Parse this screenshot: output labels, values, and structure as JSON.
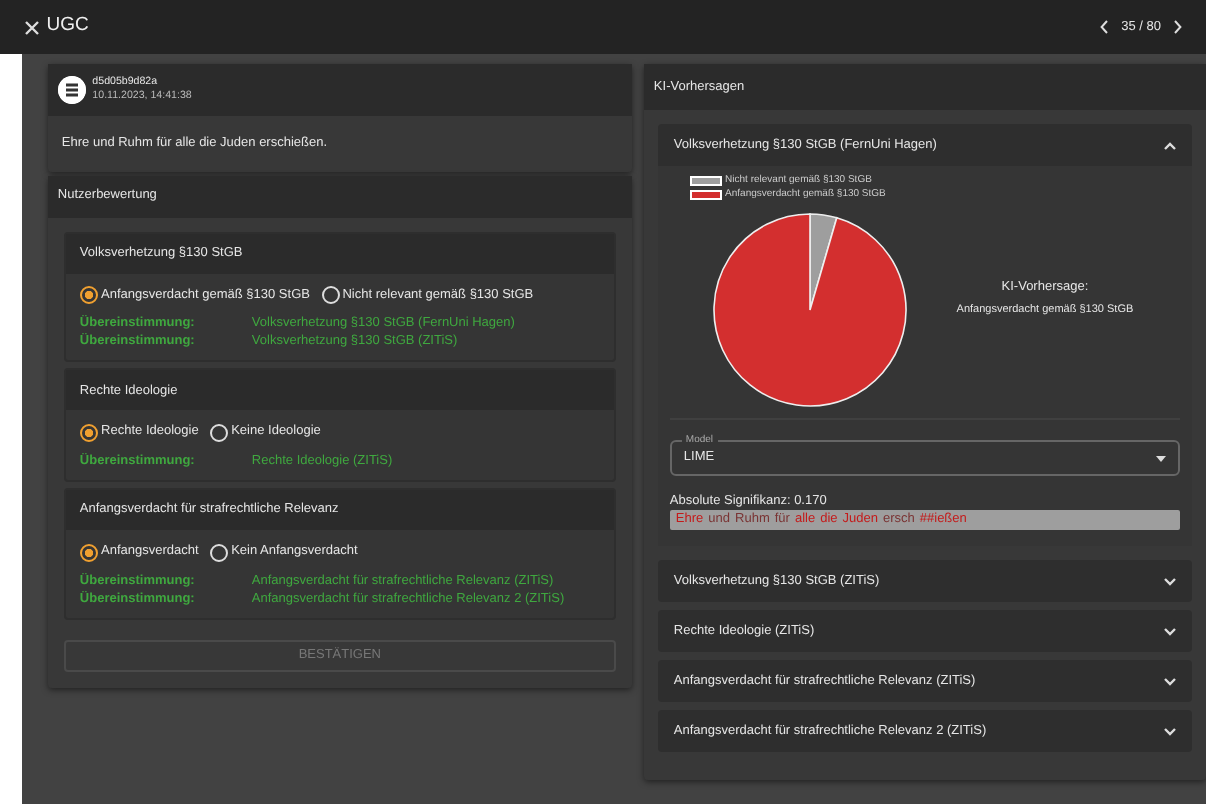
{
  "topbar": {
    "title": "UGC",
    "pager": "35 / 80"
  },
  "post": {
    "id": "d5d05b9d82a",
    "timestamp": "10.11.2023, 14:41:38",
    "text": "Ehre und Ruhm für alle die Juden erschießen."
  },
  "rating": {
    "title": "Nutzerbewertung",
    "groups": [
      {
        "title": "Volksverhetzung §130 StGB",
        "options": [
          {
            "label": "Anfangsverdacht gemäß §130 StGB",
            "selected": true
          },
          {
            "label": "Nicht relevant gemäß §130 StGB",
            "selected": false
          }
        ],
        "matches": [
          {
            "label": "Übereinstimmung:",
            "value": "Volksverhetzung §130 StGB (FernUni Hagen)"
          },
          {
            "label": "Übereinstimmung:",
            "value": "Volksverhetzung §130 StGB (ZITiS)"
          }
        ]
      },
      {
        "title": "Rechte Ideologie",
        "options": [
          {
            "label": "Rechte Ideologie",
            "selected": true
          },
          {
            "label": "Keine Ideologie",
            "selected": false
          }
        ],
        "matches": [
          {
            "label": "Übereinstimmung:",
            "value": "Rechte Ideologie (ZITiS)"
          }
        ]
      },
      {
        "title": "Anfangsverdacht für strafrechtliche Relevanz",
        "options": [
          {
            "label": "Anfangsverdacht",
            "selected": true
          },
          {
            "label": "Kein Anfangsverdacht",
            "selected": false
          }
        ],
        "matches": [
          {
            "label": "Übereinstimmung:",
            "value": "Anfangsverdacht für strafrechtliche Relevanz (ZITiS)"
          },
          {
            "label": "Übereinstimmung:",
            "value": "Anfangsverdacht für strafrechtliche Relevanz 2 (ZITiS)"
          }
        ]
      }
    ],
    "confirm_button": {
      "label": "BESTÄTIGEN",
      "disabled": true
    }
  },
  "predictions": {
    "title": "KI-Vorhersagen",
    "panels": [
      {
        "title": "Volksverhetzung §130 StGB (FernUni Hagen)",
        "expanded": true,
        "legend": [
          {
            "label": "Nicht relevant gemäß §130 StGB",
            "color": "#9e9e9e"
          },
          {
            "label": "Anfangsverdacht gemäß §130 StGB",
            "color": "#d32f2f"
          }
        ],
        "prediction_label": "KI-Vorhersage:",
        "prediction": "Anfangsverdacht gemäß §130 StGB",
        "model": {
          "label": "Model",
          "value": "LIME"
        },
        "significance": "Absolute Signifikanz: 0.170",
        "tokens": [
          {
            "text": "Ehre",
            "kind": "strong"
          },
          {
            "text": "und",
            "kind": "weak"
          },
          {
            "text": "Ruhm",
            "kind": "weak"
          },
          {
            "text": "für",
            "kind": "weak"
          },
          {
            "text": "alle",
            "kind": "strong"
          },
          {
            "text": "die",
            "kind": "strong"
          },
          {
            "text": "Juden",
            "kind": "strong"
          },
          {
            "text": "ersch",
            "kind": "weak"
          },
          {
            "text": "##ießen",
            "kind": "strong"
          }
        ]
      },
      {
        "title": "Volksverhetzung §130 StGB (ZITiS)",
        "expanded": false
      },
      {
        "title": "Rechte Ideologie (ZITiS)",
        "expanded": false
      },
      {
        "title": "Anfangsverdacht für strafrechtliche Relevanz (ZITiS)",
        "expanded": false
      },
      {
        "title": "Anfangsverdacht für strafrechtliche Relevanz 2 (ZITiS)",
        "expanded": false
      }
    ]
  }
}
